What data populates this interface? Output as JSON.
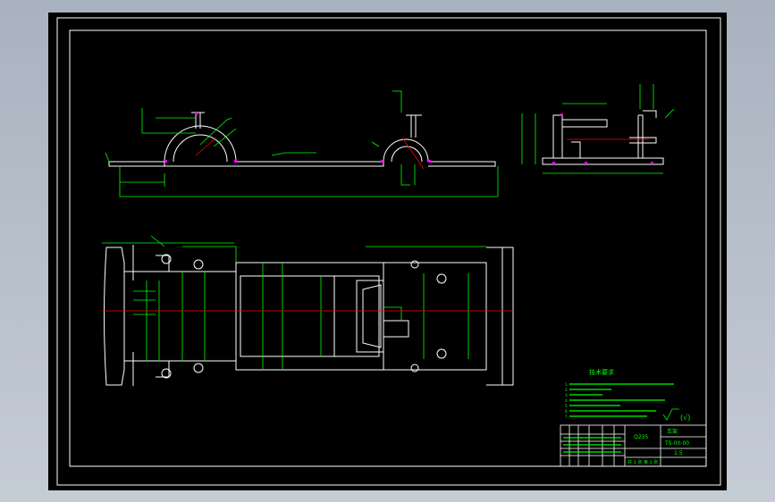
{
  "drawing": {
    "technical_requirements": {
      "heading": "技术要求",
      "lines": [
        "1. ",
        "2. ",
        "3. ",
        "4. ",
        "5. ",
        "6. ",
        "7. "
      ]
    },
    "roughness_symbol": "(√)",
    "title_block": {
      "material": "Q235",
      "drawing_name": "车架",
      "drawing_number": "TS-00-00",
      "scale": "1:5",
      "sheet": "共 1 张  第 1 张"
    }
  },
  "colors": {
    "background": "#000000",
    "outline": "#ffffff",
    "dimension": "#00ff00",
    "centerline": "#ff0000",
    "hidden": "#ff00ff"
  }
}
